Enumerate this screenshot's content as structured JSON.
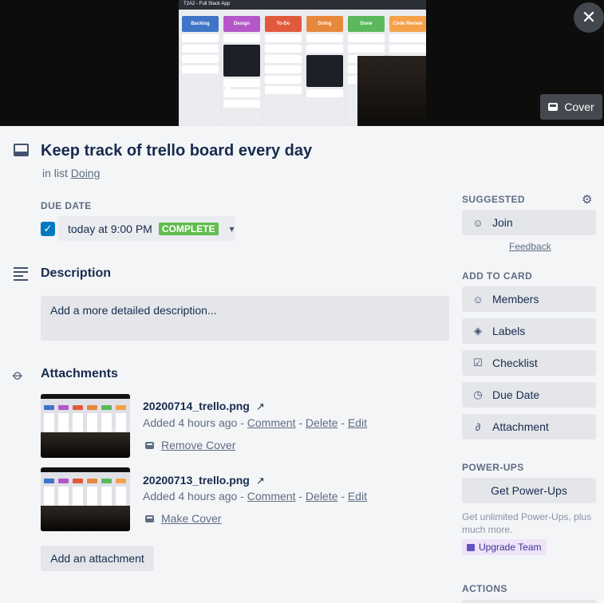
{
  "cover": {
    "screenshot_title": "T2A2 - Full Stack App",
    "columns": [
      {
        "name": "Backlog",
        "color": "#3f74c8"
      },
      {
        "name": "Design",
        "color": "#b456c8"
      },
      {
        "name": "To-Do",
        "color": "#e05a3b"
      },
      {
        "name": "Doing",
        "color": "#e8883d"
      },
      {
        "name": "Done",
        "color": "#5bb85c"
      },
      {
        "name": "Code Review",
        "color": "#f5a24a"
      }
    ],
    "cover_button_label": "Cover"
  },
  "card": {
    "title": "Keep track of trello board every day",
    "in_list_prefix": "in list",
    "list_name": "Doing"
  },
  "due_date": {
    "label": "DUE DATE",
    "checked": true,
    "value": "today at 9:00 PM",
    "badge": "COMPLETE"
  },
  "description": {
    "heading": "Description",
    "placeholder": "Add a more detailed description..."
  },
  "attachments": {
    "heading": "Attachments",
    "items": [
      {
        "name": "20200714_trello.png",
        "arrow": "↗",
        "added": "Added 4 hours ago",
        "sep1": " - ",
        "comment": "Comment",
        "sep2": " - ",
        "delete": "Delete",
        "sep3": " - ",
        "edit": "Edit",
        "cover_action": "Remove Cover"
      },
      {
        "name": "20200713_trello.png",
        "arrow": "↗",
        "added": "Added 4 hours ago",
        "sep1": " - ",
        "comment": "Comment",
        "sep2": " - ",
        "delete": "Delete",
        "sep3": " - ",
        "edit": "Edit",
        "cover_action": "Make Cover"
      }
    ],
    "add_button": "Add an attachment"
  },
  "sidebar": {
    "suggested_label": "SUGGESTED",
    "join": "Join",
    "feedback": "Feedback",
    "add_to_card_label": "ADD TO CARD",
    "members": "Members",
    "labels": "Labels",
    "checklist": "Checklist",
    "due_date": "Due Date",
    "attachment": "Attachment",
    "power_ups_label": "POWER-UPS",
    "get_power_ups": "Get Power-Ups",
    "power_ups_note": "Get unlimited Power-Ups, plus much more.",
    "upgrade_team": "Upgrade Team",
    "actions_label": "ACTIONS"
  }
}
